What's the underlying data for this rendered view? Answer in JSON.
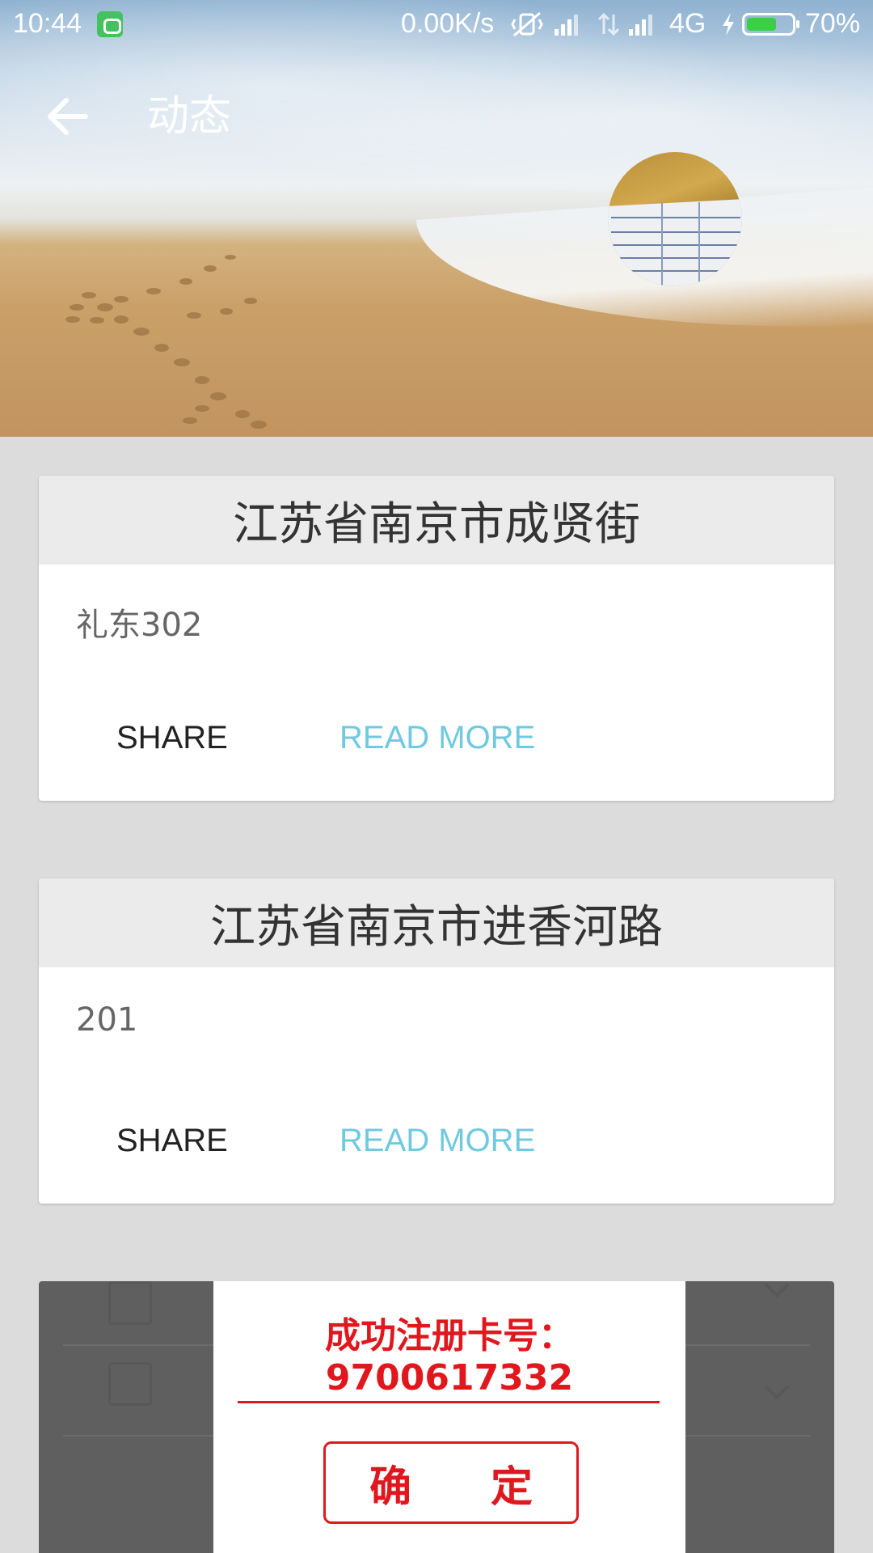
{
  "status_bar": {
    "time": "10:44",
    "network_speed": "0.00K/s",
    "network_type": "4G",
    "battery_percent": "70%",
    "battery_level": 0.7,
    "icons": [
      "app-notification-icon",
      "vibrate-icon",
      "signal-icon",
      "data-arrows-icon",
      "signal-icon",
      "charging-icon",
      "battery-icon"
    ]
  },
  "app_bar": {
    "title": "动态",
    "back_icon": "arrow-left-icon"
  },
  "posts": [
    {
      "title": "江苏省南京市成贤街",
      "body": "礼东302",
      "share_label": "SHARE",
      "read_more_label": "READ MORE"
    },
    {
      "title": "江苏省南京市进香河路",
      "body": "201",
      "share_label": "SHARE",
      "read_more_label": "READ MORE"
    }
  ],
  "dialog": {
    "message_line1": "成功注册卡号：",
    "message_line2": "9700617332",
    "confirm_label": "确 定"
  },
  "colors": {
    "accent_red": "#e0181e",
    "read_more": "#6fcadf",
    "battery_green": "#39d047"
  }
}
